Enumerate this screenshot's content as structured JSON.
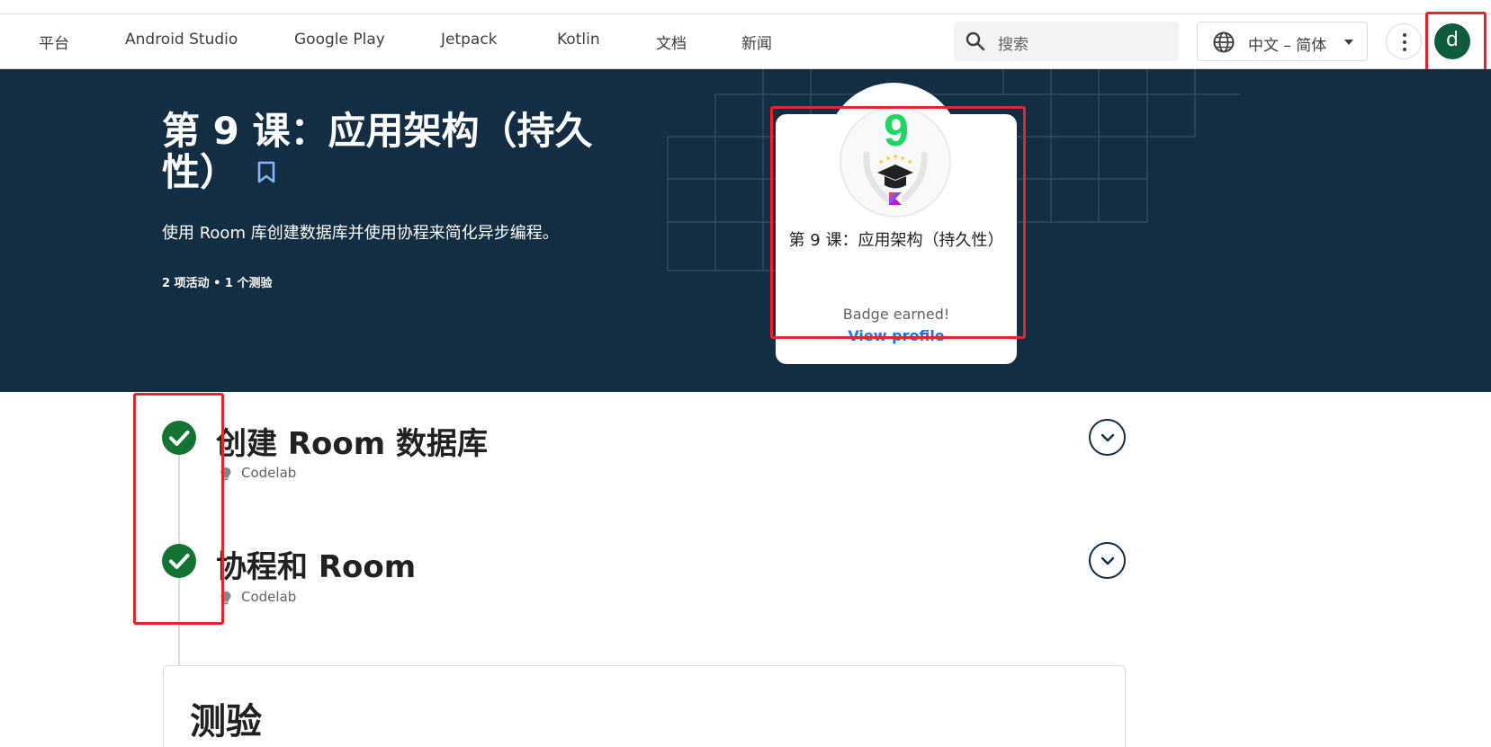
{
  "nav": {
    "items": [
      "平台",
      "Android Studio",
      "Google Play",
      "Jetpack",
      "Kotlin",
      "文档",
      "新闻"
    ],
    "search_placeholder": "搜索",
    "language": "中文 – 简体",
    "avatar_letter": "d"
  },
  "hero": {
    "title": "第 9 课：应用架构（持久性）",
    "description": "使用 Room 库创建数据库并使用协程来简化异步编程。",
    "meta": "2 项活动 • 1 个测验"
  },
  "badge": {
    "number": "9",
    "title": "第 9 课：应用架构（持久性）",
    "earned_text": "Badge earned!",
    "link_text": "View profile"
  },
  "activities": [
    {
      "title": "创建 Room 数据库",
      "type": "Codelab",
      "completed": true
    },
    {
      "title": "协程和 Room",
      "type": "Codelab",
      "completed": true
    }
  ],
  "quiz": {
    "title": "测验"
  },
  "colors": {
    "hero_bg": "#132e42",
    "check_green": "#137333",
    "avatar_green": "#0d5c3d",
    "link_blue": "#1a73e8",
    "annotation_red": "#e8232a"
  }
}
